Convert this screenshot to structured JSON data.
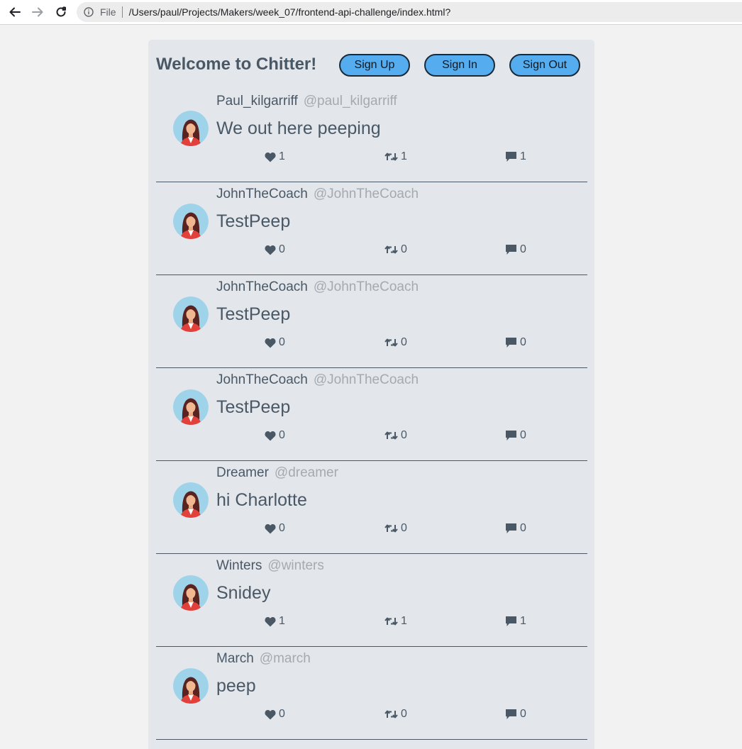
{
  "browser": {
    "scheme_label": "File",
    "url": "/Users/paul/Projects/Makers/week_07/frontend-api-challenge/index.html?"
  },
  "header": {
    "title": "Welcome to Chitter!",
    "sign_up_label": "Sign Up",
    "sign_in_label": "Sign In",
    "sign_out_label": "Sign Out"
  },
  "colors": {
    "accent_button": "#55acee",
    "panel": "#e3e7ec",
    "text": "#4a5866",
    "handle": "#a5aab0"
  },
  "icons": [
    "back-arrow-icon",
    "forward-arrow-icon",
    "reload-icon",
    "info-icon",
    "heart-icon",
    "retweet-icon",
    "comment-icon",
    "avatar-icon"
  ],
  "peeps": [
    {
      "name": "Paul_kilgarriff",
      "handle": "@paul_kilgarriff",
      "body": "We out here peeping",
      "likes": "1",
      "retweets": "1",
      "replies": "1"
    },
    {
      "name": "JohnTheCoach",
      "handle": "@JohnTheCoach",
      "body": "TestPeep",
      "likes": "0",
      "retweets": "0",
      "replies": "0"
    },
    {
      "name": "JohnTheCoach",
      "handle": "@JohnTheCoach",
      "body": "TestPeep",
      "likes": "0",
      "retweets": "0",
      "replies": "0"
    },
    {
      "name": "JohnTheCoach",
      "handle": "@JohnTheCoach",
      "body": "TestPeep",
      "likes": "0",
      "retweets": "0",
      "replies": "0"
    },
    {
      "name": "Dreamer",
      "handle": "@dreamer",
      "body": "hi Charlotte",
      "likes": "0",
      "retweets": "0",
      "replies": "0"
    },
    {
      "name": "Winters",
      "handle": "@winters",
      "body": "Snidey",
      "likes": "1",
      "retweets": "1",
      "replies": "1"
    },
    {
      "name": "March",
      "handle": "@march",
      "body": "peep",
      "likes": "0",
      "retweets": "0",
      "replies": "0"
    }
  ]
}
